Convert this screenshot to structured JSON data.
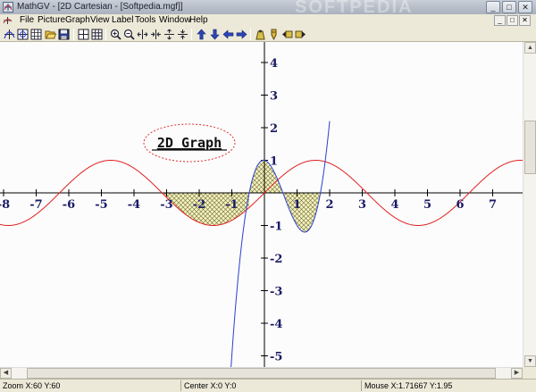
{
  "window": {
    "title": "MathGV - [2D Cartesian - [Softpedia.mgf]]",
    "watermark": "SOFTPEDIA",
    "controls": [
      "_",
      "□",
      "✕"
    ]
  },
  "menu": [
    "File",
    "Picture",
    "Graph",
    "View",
    "Label",
    "Tools",
    "Window",
    "Help"
  ],
  "mdi_controls": [
    "_",
    "□",
    "✕"
  ],
  "toolbar": {
    "groups": [
      [
        "graph-icon",
        "graph-options-icon",
        "grid-icon",
        "open-icon",
        "save-icon"
      ],
      [
        "tile-icon",
        "tile-grid-icon"
      ],
      [
        "zoom-in-icon",
        "zoom-out-icon",
        "stretch-x-icon",
        "shrink-x-icon",
        "stretch-y-icon",
        "shrink-y-icon"
      ],
      [
        "arrow-up-icon",
        "arrow-down-icon",
        "arrow-left-icon",
        "arrow-right-icon"
      ],
      [
        "label-icon",
        "marker-icon",
        "label-left-icon",
        "label-right-icon"
      ]
    ]
  },
  "graph": {
    "label_text": "2D Graph",
    "x_ticks": [
      "-8",
      "-7",
      "-6",
      "-5",
      "-4",
      "-3",
      "-2",
      "-1",
      "1",
      "2",
      "3",
      "4",
      "5",
      "6",
      "7"
    ],
    "y_ticks": [
      "4",
      "3",
      "2",
      "1",
      "-1",
      "-2",
      "-3",
      "-4",
      "-5"
    ],
    "colors": {
      "sine": "#e02020",
      "poly": "#2a3fcf",
      "hatch": "#6b6b2a",
      "fill": "#f6f1c4",
      "axis": "#000000",
      "label_ellipse": "#e03030"
    }
  },
  "status": {
    "zoom": "Zoom X:60 Y:60",
    "center": "Center X:0 Y:0",
    "mouse": "Mouse X:1.71667 Y:1.95"
  }
}
